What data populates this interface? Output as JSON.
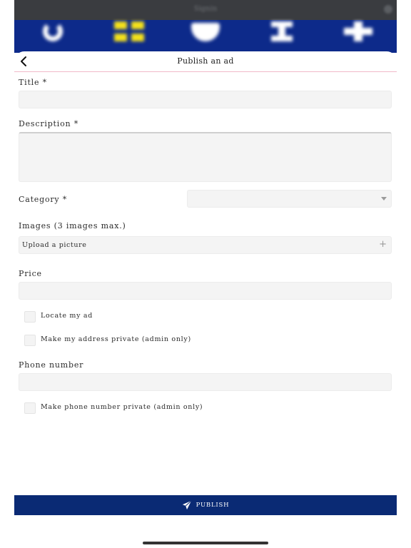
{
  "background": {
    "title": "Signin",
    "topbar_color": "#3a3c40",
    "iconbar_color": "#0d2a8a",
    "icons": [
      "horseshoe-icon",
      "grid-icon",
      "shield-icon",
      "hourglass-icon",
      "plus-icon"
    ]
  },
  "header": {
    "title": "Publish an ad",
    "back_icon": "chevron-left-icon",
    "divider_color": "#f1b9c8"
  },
  "form": {
    "title_label": "Title *",
    "title_value": "",
    "description_label": "Description *",
    "description_value": "",
    "category_label": "Category *",
    "category_value": "",
    "images_label": "Images (3 images max.)",
    "upload_label": "Upload a picture",
    "upload_icon": "plus-icon",
    "price_label": "Price",
    "price_value": "",
    "locate_label": "Locate my ad",
    "locate_checked": false,
    "address_private_label": "Make my address private (admin only)",
    "address_private_checked": false,
    "phone_label": "Phone number",
    "phone_value": "",
    "phone_private_label": "Make phone number private (admin only)",
    "phone_private_checked": false
  },
  "publish": {
    "label": "PUBLISH",
    "icon": "send-icon",
    "color": "#0a2a74"
  }
}
